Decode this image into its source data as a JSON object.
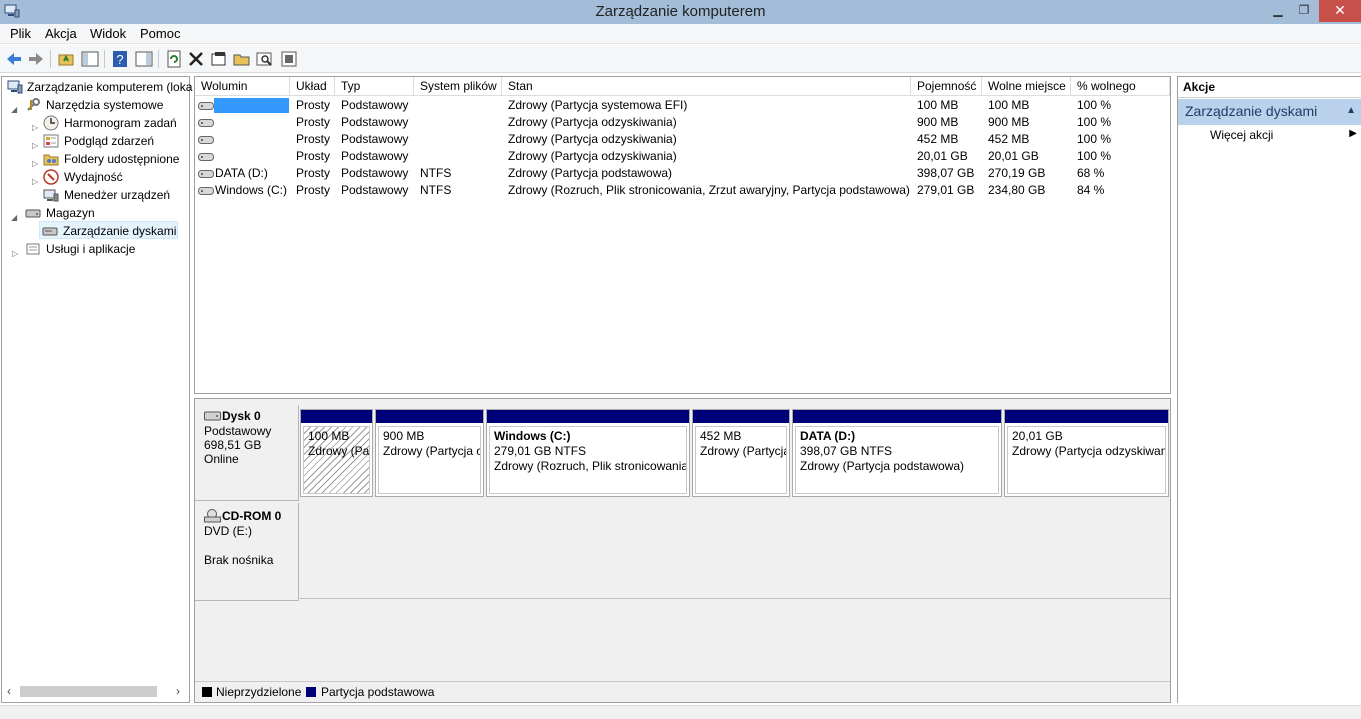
{
  "window": {
    "title": "Zarządzanie komputerem",
    "min_glyph": "▁",
    "max_glyph": "❐",
    "close_glyph": "✕"
  },
  "menu": [
    "Plik",
    "Akcja",
    "Widok",
    "Pomoc"
  ],
  "toolbar_icons": [
    "back-icon",
    "forward-icon",
    "up-folder-icon",
    "show-tree-icon",
    "help-icon",
    "show-action-pane-icon",
    "refresh-icon",
    "delete-icon",
    "properties-icon",
    "open-icon",
    "search-icon",
    "settings-icon"
  ],
  "tree": {
    "items": [
      {
        "label": "Zarządzanie komputerem (loka",
        "level": 0,
        "expander": "",
        "icon": "computer-icon"
      },
      {
        "label": "Narzędzia systemowe",
        "level": 1,
        "expander": "◢",
        "icon": "tools-icon"
      },
      {
        "label": "Harmonogram zadań",
        "level": 2,
        "expander": "▷",
        "icon": "clock-icon"
      },
      {
        "label": "Podgląd zdarzeń",
        "level": 2,
        "expander": "▷",
        "icon": "event-viewer-icon"
      },
      {
        "label": "Foldery udostępnione",
        "level": 2,
        "expander": "▷",
        "icon": "shared-folder-icon"
      },
      {
        "label": "Wydajność",
        "level": 2,
        "expander": "▷",
        "icon": "performance-icon"
      },
      {
        "label": "Menedżer urządzeń",
        "level": 2,
        "expander": "",
        "icon": "device-manager-icon"
      },
      {
        "label": "Magazyn",
        "level": 1,
        "expander": "◢",
        "icon": "storage-icon"
      },
      {
        "label": "Zarządzanie dyskami",
        "level": 2,
        "expander": "",
        "icon": "disk-management-icon"
      },
      {
        "label": "Usługi i aplikacje",
        "level": 1,
        "expander": "▷",
        "icon": "services-icon"
      }
    ]
  },
  "volumes": {
    "columns": [
      "Wolumin",
      "Układ",
      "Typ",
      "System plików",
      "Stan",
      "Pojemność",
      "Wolne miejsce",
      "% wolnego"
    ],
    "rows": [
      [
        "",
        "Prosty",
        "Podstawowy",
        "",
        "Zdrowy (Partycja systemowa EFI)",
        "100 MB",
        "100 MB",
        "100 %"
      ],
      [
        "",
        "Prosty",
        "Podstawowy",
        "",
        "Zdrowy (Partycja odzyskiwania)",
        "900 MB",
        "900 MB",
        "100 %"
      ],
      [
        "",
        "Prosty",
        "Podstawowy",
        "",
        "Zdrowy (Partycja odzyskiwania)",
        "452 MB",
        "452 MB",
        "100 %"
      ],
      [
        "",
        "Prosty",
        "Podstawowy",
        "",
        "Zdrowy (Partycja odzyskiwania)",
        "20,01 GB",
        "20,01 GB",
        "100 %"
      ],
      [
        "DATA (D:)",
        "Prosty",
        "Podstawowy",
        "NTFS",
        "Zdrowy (Partycja podstawowa)",
        "398,07 GB",
        "270,19 GB",
        "68 %"
      ],
      [
        "Windows (C:)",
        "Prosty",
        "Podstawowy",
        "NTFS",
        "Zdrowy (Rozruch, Plik stronicowania, Zrzut awaryjny, Partycja podstawowa)",
        "279,01 GB",
        "234,80 GB",
        "84 %"
      ]
    ]
  },
  "disks": {
    "disk0": {
      "name": "Dysk 0",
      "type": "Podstawowy",
      "size": "698,51 GB",
      "status": "Online"
    },
    "partitions": [
      {
        "name": "",
        "line1": "100 MB",
        "line2": "Zdrowy (Partycja systemowa EFI)"
      },
      {
        "name": "",
        "line1": "900 MB",
        "line2": "Zdrowy (Partycja odzyskiwania)"
      },
      {
        "name": "Windows  (C:)",
        "line1": "279,01 GB NTFS",
        "line2": "Zdrowy (Rozruch, Plik stronicowania, Zrzut awaryjny, Partycja podstawowa)"
      },
      {
        "name": "",
        "line1": "452 MB",
        "line2": "Zdrowy (Partycja odzyskiwania)"
      },
      {
        "name": "DATA  (D:)",
        "line1": "398,07 GB NTFS",
        "line2": "Zdrowy (Partycja podstawowa)"
      },
      {
        "name": "",
        "line1": "20,01 GB",
        "line2": "Zdrowy (Partycja odzyskiwania)"
      }
    ],
    "cdrom": {
      "name": "CD-ROM 0",
      "drive": "DVD (E:)",
      "status": "Brak nośnika"
    }
  },
  "legend": [
    {
      "label": "Nieprzydzielone",
      "color": "#000000"
    },
    {
      "label": "Partycja podstawowa",
      "color": "#00007b"
    }
  ],
  "actions": {
    "header": "Akcje",
    "section": "Zarządzanie dyskami",
    "item": "Więcej akcji"
  },
  "colors": {
    "titlebar": "#a3bcd7",
    "partition_bar": "#00007b",
    "selection": "#3399ff",
    "close_button": "#c7504b",
    "actions_section": "#b9d1ea"
  }
}
